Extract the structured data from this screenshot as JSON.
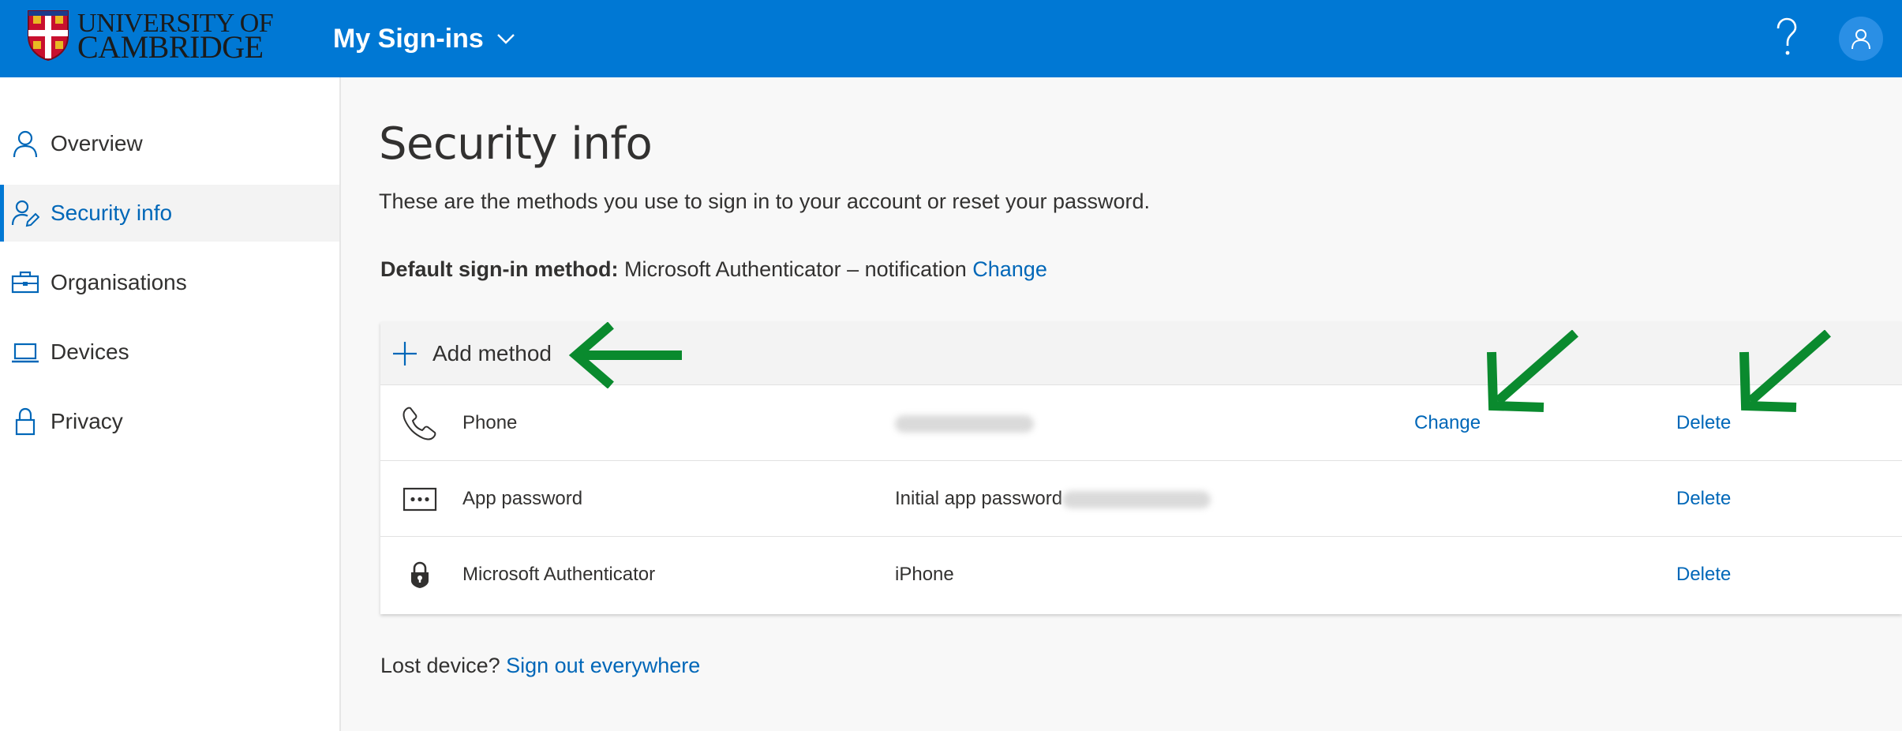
{
  "header": {
    "logo_line1": "UNIVERSITY OF",
    "logo_line2": "CAMBRIDGE",
    "app_title": "My Sign-ins",
    "help_icon": "question-mark-icon",
    "avatar_icon": "person-icon"
  },
  "sidebar": {
    "items": [
      {
        "label": "Overview",
        "icon": "person-icon"
      },
      {
        "label": "Security info",
        "icon": "person-edit-icon",
        "active": true
      },
      {
        "label": "Organisations",
        "icon": "briefcase-icon"
      },
      {
        "label": "Devices",
        "icon": "laptop-icon"
      },
      {
        "label": "Privacy",
        "icon": "lock-icon"
      }
    ]
  },
  "main": {
    "title": "Security info",
    "description": "These are the methods you use to sign in to your account or reset your password.",
    "default_method": {
      "label": "Default sign-in method:",
      "value": "Microsoft Authenticator – notification",
      "change_link": "Change"
    },
    "add_method_label": "Add method",
    "methods": [
      {
        "icon": "phone-icon",
        "name": "Phone",
        "detail": "",
        "change": "Change",
        "delete": "Delete"
      },
      {
        "icon": "app-password-icon",
        "name": "App password",
        "detail": "Initial app password",
        "change": "",
        "delete": "Delete"
      },
      {
        "icon": "authenticator-lock-icon",
        "name": "Microsoft Authenticator",
        "detail": "iPhone",
        "change": "",
        "delete": "Delete"
      }
    ],
    "lost_device": {
      "text": "Lost device?",
      "link": "Sign out everywhere"
    }
  },
  "colors": {
    "header_bg": "#0078d4",
    "link": "#0067b8",
    "annotation_arrow": "#0a8a2e",
    "sidebar_active_bar": "#0078d4"
  }
}
